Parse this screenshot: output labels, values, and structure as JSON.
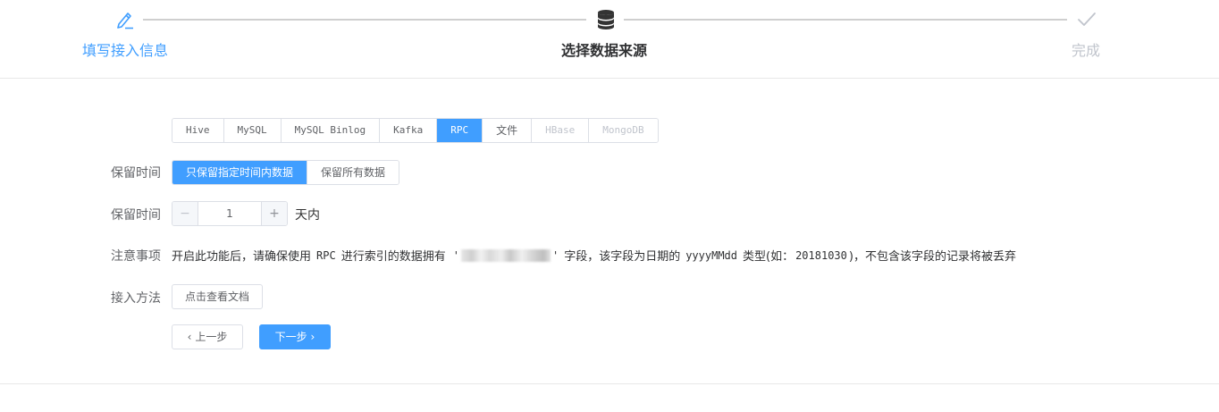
{
  "steps": {
    "items": [
      {
        "label": "填写接入信息",
        "icon": "edit-icon",
        "state": "done"
      },
      {
        "label": "选择数据来源",
        "icon": "database-icon",
        "state": "active"
      },
      {
        "label": "完成",
        "icon": "check-icon",
        "state": "pending"
      }
    ]
  },
  "source_tabs": {
    "items": [
      {
        "label": "Hive",
        "state": "normal"
      },
      {
        "label": "MySQL",
        "state": "normal"
      },
      {
        "label": "MySQL Binlog",
        "state": "normal"
      },
      {
        "label": "Kafka",
        "state": "normal"
      },
      {
        "label": "RPC",
        "state": "active"
      },
      {
        "label": "文件",
        "state": "normal"
      },
      {
        "label": "HBase",
        "state": "disabled"
      },
      {
        "label": "MongoDB",
        "state": "disabled"
      }
    ]
  },
  "retention": {
    "label": "保留时间",
    "options": [
      {
        "label": "只保留指定时间内数据",
        "active": true
      },
      {
        "label": "保留所有数据",
        "active": false
      }
    ]
  },
  "retention_days": {
    "label": "保留时间",
    "value": "1",
    "unit": "天内"
  },
  "notice": {
    "label": "注意事项",
    "text_1": "开启此功能后，请确保使用",
    "text_rpc": "RPC",
    "text_2": "进行索引的数据拥有",
    "quote_open": "'",
    "quote_close": "'",
    "text_3": "字段，该字段为日期的",
    "text_fmt": "yyyyMMdd",
    "text_4": "类型(如：",
    "text_example": "20181030",
    "text_5": ")，不包含该字段的记录将被丢弃"
  },
  "access": {
    "label": "接入方法",
    "doc_button": "点击查看文档"
  },
  "nav": {
    "prev": "上一步",
    "next": "下一步"
  },
  "colors": {
    "primary": "#409eff",
    "border": "#dcdfe6",
    "disabled_text": "#c0c4cc"
  }
}
